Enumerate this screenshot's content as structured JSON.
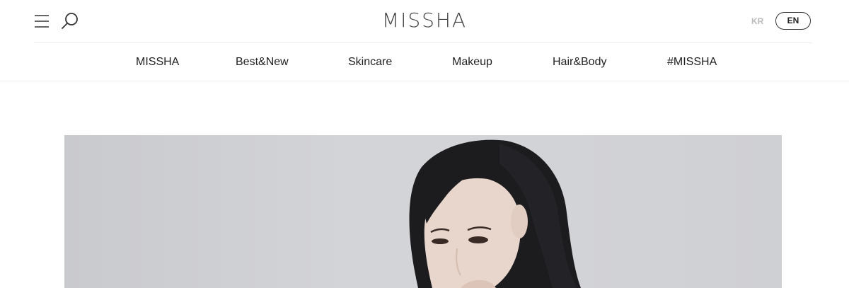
{
  "header": {
    "logo_text": "MISSHA",
    "lang_kr": "KR",
    "lang_en": "EN",
    "menu_icon": "hamburger-menu-icon",
    "search_icon": "search-icon"
  },
  "nav": {
    "items": [
      {
        "label": "MISSHA"
      },
      {
        "label": "Best&New"
      },
      {
        "label": "Skincare"
      },
      {
        "label": "Makeup"
      },
      {
        "label": "Hair&Body"
      },
      {
        "label": "#MISSHA"
      }
    ]
  },
  "hero": {
    "background_color": "#cfd0d4",
    "content": "model-portrait-image"
  },
  "colors": {
    "text": "#222222",
    "muted": "#bbbbbb",
    "divider": "#eeeeee"
  }
}
